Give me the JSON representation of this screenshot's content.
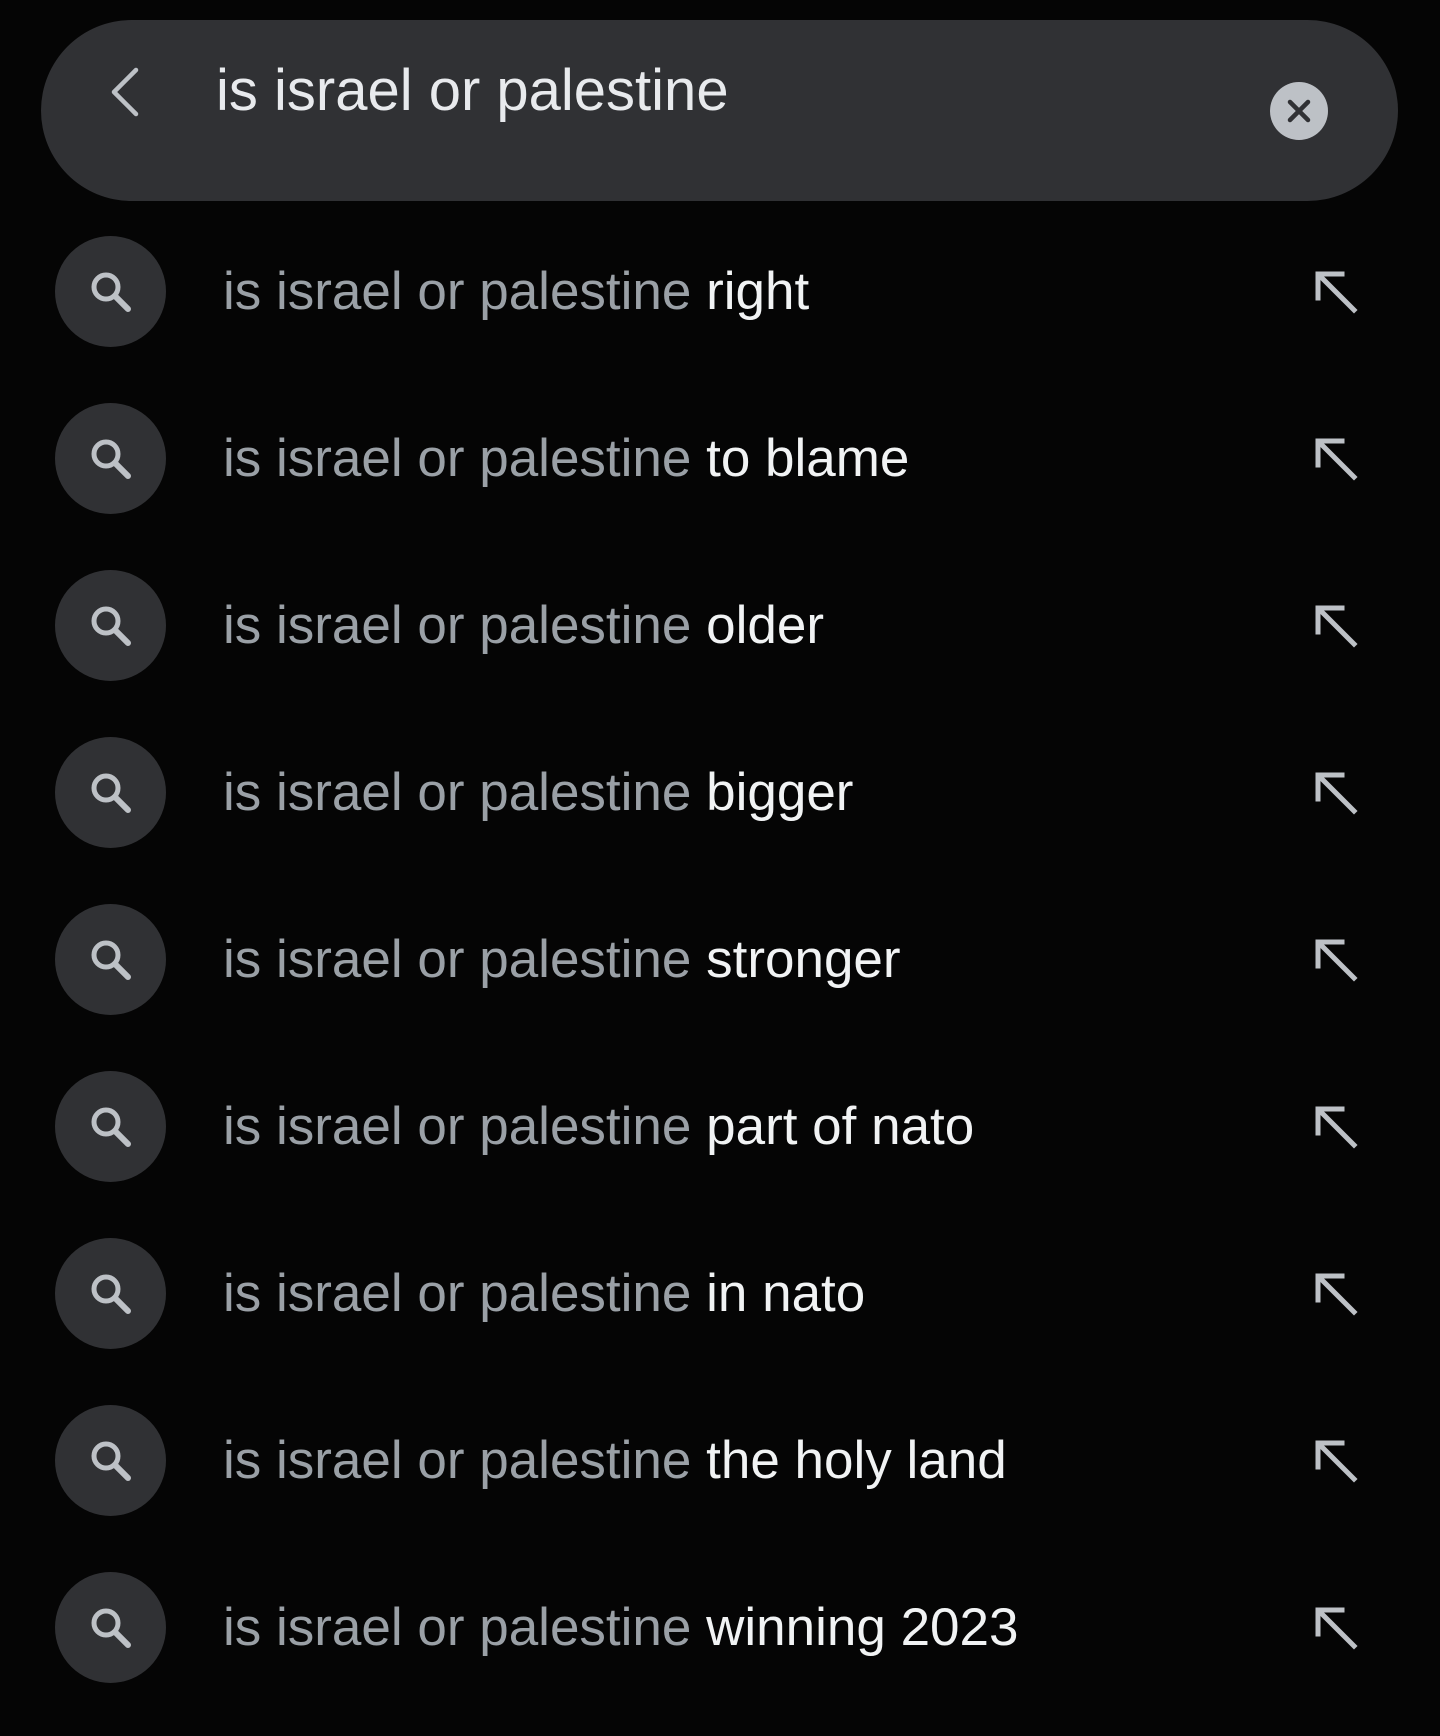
{
  "search": {
    "query": "is israel or palestine",
    "back_icon": "chevron-left-icon",
    "clear_icon": "close-icon"
  },
  "suggestions": [
    {
      "prefix": "is israel or palestine",
      "completion": "right"
    },
    {
      "prefix": "is israel or palestine",
      "completion": "to blame"
    },
    {
      "prefix": "is israel or palestine",
      "completion": "older"
    },
    {
      "prefix": "is israel or palestine",
      "completion": "bigger"
    },
    {
      "prefix": "is israel or palestine",
      "completion": "stronger"
    },
    {
      "prefix": "is israel or palestine",
      "completion": "part of nato"
    },
    {
      "prefix": "is israel or palestine",
      "completion": "in nato"
    },
    {
      "prefix": "is israel or palestine",
      "completion": "the holy land"
    },
    {
      "prefix": "is israel or palestine",
      "completion": "winning 2023"
    }
  ],
  "colors": {
    "background": "#050505",
    "surface": "#303134",
    "muted_text": "#9aa0a6",
    "text": "#f1f3f4"
  }
}
